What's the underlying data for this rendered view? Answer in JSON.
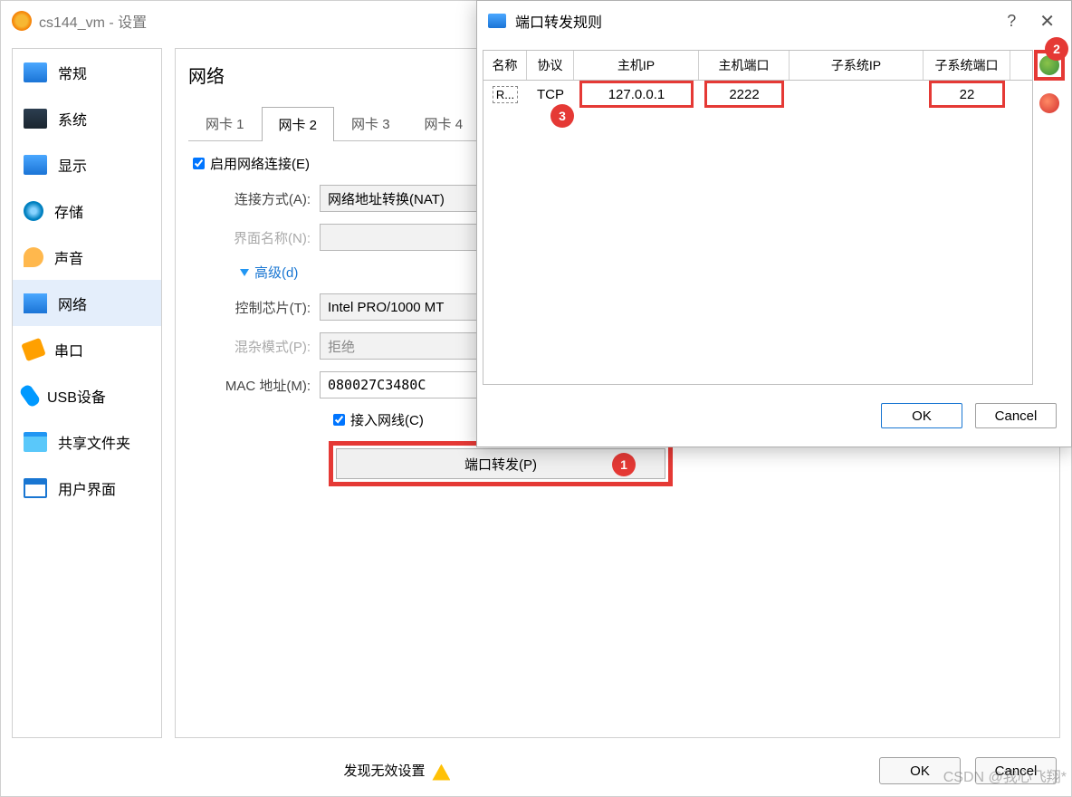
{
  "mainWindow": {
    "title": "cs144_vm - 设置",
    "footer": {
      "invalid": "发现无效设置",
      "ok": "OK",
      "cancel": "Cancel"
    }
  },
  "sidebar": {
    "items": [
      {
        "label": "常规"
      },
      {
        "label": "系统"
      },
      {
        "label": "显示"
      },
      {
        "label": "存储"
      },
      {
        "label": "声音"
      },
      {
        "label": "网络"
      },
      {
        "label": "串口"
      },
      {
        "label": "USB设备"
      },
      {
        "label": "共享文件夹"
      },
      {
        "label": "用户界面"
      }
    ]
  },
  "detail": {
    "heading": "网络",
    "tabs": [
      "网卡 1",
      "网卡 2",
      "网卡 3",
      "网卡 4"
    ],
    "activeTab": 1,
    "enableLabel": "启用网络连接(E)",
    "attach": {
      "label": "连接方式(A):",
      "value": "网络地址转换(NAT)"
    },
    "iface": {
      "label": "界面名称(N):",
      "value": ""
    },
    "advanced": "高级(d)",
    "chip": {
      "label": "控制芯片(T):",
      "value": "Intel PRO/1000 MT"
    },
    "promisc": {
      "label": "混杂模式(P):",
      "value": "拒绝"
    },
    "mac": {
      "label": "MAC 地址(M):",
      "value": "080027C3480C"
    },
    "cable": "接入网线(C)",
    "pfBtn": "端口转发(P)"
  },
  "dialog": {
    "title": "端口转发规则",
    "ok": "OK",
    "cancel": "Cancel",
    "columns": {
      "name": "名称",
      "proto": "协议",
      "hip": "主机IP",
      "hport": "主机端口",
      "sip": "子系统IP",
      "sport": "子系统端口"
    },
    "row": {
      "name": "R...",
      "proto": "TCP",
      "hip": "127.0.0.1",
      "hport": "2222",
      "sip": "",
      "sport": "22"
    }
  },
  "annotations": {
    "a1": "1",
    "a2": "2",
    "a3": "3"
  },
  "watermark": "CSDN @我心飞翔*"
}
